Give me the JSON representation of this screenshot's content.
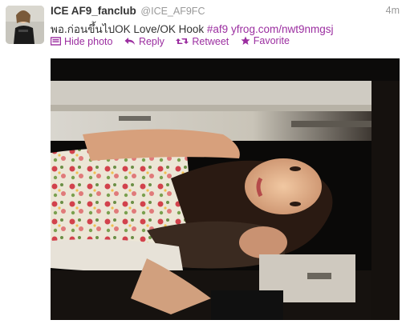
{
  "tweet": {
    "fullname": "ICE AF9_fanclub",
    "username": "@ICE_AF9FC",
    "time": "4m",
    "text_main": "พอ.ก่อนขึ้นไปOK Love/OK Hook ",
    "hashtag": "#af9",
    "url": "yfrog.com/nwt9nmgsj",
    "actions": {
      "hide_photo": "Hide photo",
      "reply": "Reply",
      "retweet": "Retweet",
      "favorite": "Favorite"
    }
  },
  "colors": {
    "accent": "#9b2ea0",
    "muted": "#999999",
    "text": "#333333"
  },
  "icons": [
    "photo-icon",
    "reply-icon",
    "retweet-icon",
    "star-icon"
  ]
}
